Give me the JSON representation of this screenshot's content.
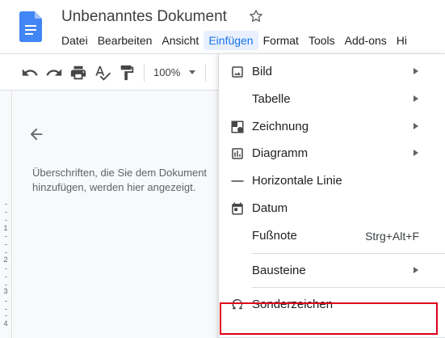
{
  "document": {
    "title": "Unbenanntes Dokument"
  },
  "menubar": {
    "items": [
      "Datei",
      "Bearbeiten",
      "Ansicht",
      "Einfügen",
      "Format",
      "Tools",
      "Add-ons",
      "Hi"
    ]
  },
  "toolbar": {
    "zoom": "100%"
  },
  "ruler": {
    "numbers": [
      "1",
      "2",
      "3",
      "4"
    ]
  },
  "outline": {
    "message": "Überschriften, die Sie dem Dokument hinzufügen, werden hier angezeigt."
  },
  "insert_menu": {
    "items": [
      {
        "label": "Bild",
        "icon": "image-icon",
        "submenu": true
      },
      {
        "label": "Tabelle",
        "icon": "",
        "submenu": true
      },
      {
        "label": "Zeichnung",
        "icon": "drawing-icon",
        "submenu": true
      },
      {
        "label": "Diagramm",
        "icon": "chart-icon",
        "submenu": true
      },
      {
        "label": "Horizontale Linie",
        "icon": "horizontal-line-icon",
        "submenu": false
      },
      {
        "label": "Datum",
        "icon": "calendar-icon",
        "submenu": false
      },
      {
        "label": "Fußnote",
        "icon": "",
        "submenu": false,
        "shortcut": "Strg+Alt+F"
      },
      {
        "label": "Bausteine",
        "icon": "",
        "submenu": true
      },
      {
        "label": "Sonderzeichen",
        "icon": "omega-icon",
        "submenu": false
      }
    ]
  },
  "colors": {
    "accent": "#1a73e8",
    "highlight": "#e0001a",
    "doc_blue": "#4285f4"
  }
}
